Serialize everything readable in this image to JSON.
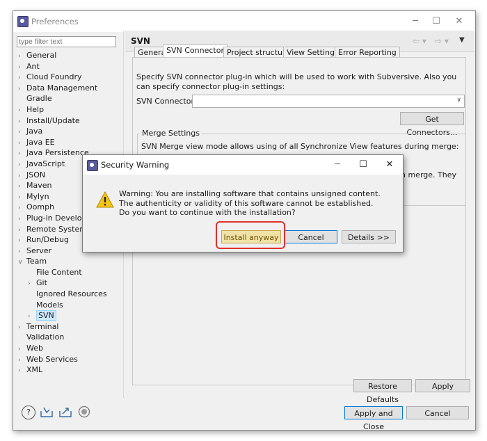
{
  "window": {
    "title": "Preferences"
  },
  "filter": {
    "placeholder": "type filter text"
  },
  "tree": [
    {
      "label": "General",
      "chev": ">"
    },
    {
      "label": "Ant",
      "chev": ">"
    },
    {
      "label": "Cloud Foundry",
      "chev": ">"
    },
    {
      "label": "Data Management",
      "chev": ">"
    },
    {
      "label": "Gradle",
      "chev": ""
    },
    {
      "label": "Help",
      "chev": ">"
    },
    {
      "label": "Install/Update",
      "chev": ">"
    },
    {
      "label": "Java",
      "chev": ">"
    },
    {
      "label": "Java EE",
      "chev": ">"
    },
    {
      "label": "Java Persistence",
      "chev": ">"
    },
    {
      "label": "JavaScript",
      "chev": ">"
    },
    {
      "label": "JSON",
      "chev": ">"
    },
    {
      "label": "Maven",
      "chev": ">"
    },
    {
      "label": "Mylyn",
      "chev": ">"
    },
    {
      "label": "Oomph",
      "chev": ">"
    },
    {
      "label": "Plug-in Developm",
      "chev": ">"
    },
    {
      "label": "Remote Systems",
      "chev": ">"
    },
    {
      "label": "Run/Debug",
      "chev": ">"
    },
    {
      "label": "Server",
      "chev": ">"
    },
    {
      "label": "Team",
      "chev": "v"
    },
    {
      "label": "File Content",
      "chev": ""
    },
    {
      "label": "Git",
      "chev": ">"
    },
    {
      "label": "Ignored Resources",
      "chev": ""
    },
    {
      "label": "Models",
      "chev": ""
    },
    {
      "label": "SVN",
      "chev": ">"
    },
    {
      "label": "Terminal",
      "chev": ">"
    },
    {
      "label": "Validation",
      "chev": ""
    },
    {
      "label": "Web",
      "chev": ">"
    },
    {
      "label": "Web Services",
      "chev": ">"
    },
    {
      "label": "XML",
      "chev": ">"
    }
  ],
  "page": {
    "title": "SVN",
    "tabs": [
      "General",
      "SVN Connector",
      "Project structure",
      "View Settings",
      "Error Reporting"
    ],
    "selected_tab": "SVN Connector",
    "description": "Specify SVN connector plug-in which will be used to work with Subversive. Also you can specify connector plug-in settings:",
    "connector_label": "SVN Connector:",
    "connector_value": "",
    "get_connectors": "Get Connectors...",
    "merge_group": "Merge Settings",
    "merge_text": "SVN Merge view mode allows using of all Synchronize View features during merge:",
    "merge_partial": "n merge. They",
    "restore_defaults": "Restore Defaults",
    "apply": "Apply"
  },
  "footer": {
    "apply_close": "Apply and Close",
    "cancel": "Cancel",
    "icons": [
      "help-icon",
      "import-icon",
      "export-icon",
      "record-icon"
    ]
  },
  "dialog": {
    "title": "Security Warning",
    "message": "Warning: You are installing software that contains unsigned content. The authenticity or validity of this software cannot be established. Do you want to continue with the installation?",
    "install": "Install anyway",
    "cancel": "Cancel",
    "details": "Details >>"
  },
  "colors": {
    "accent": "#0078d7",
    "highlight": "#e03030",
    "warning": "#f5c518"
  }
}
